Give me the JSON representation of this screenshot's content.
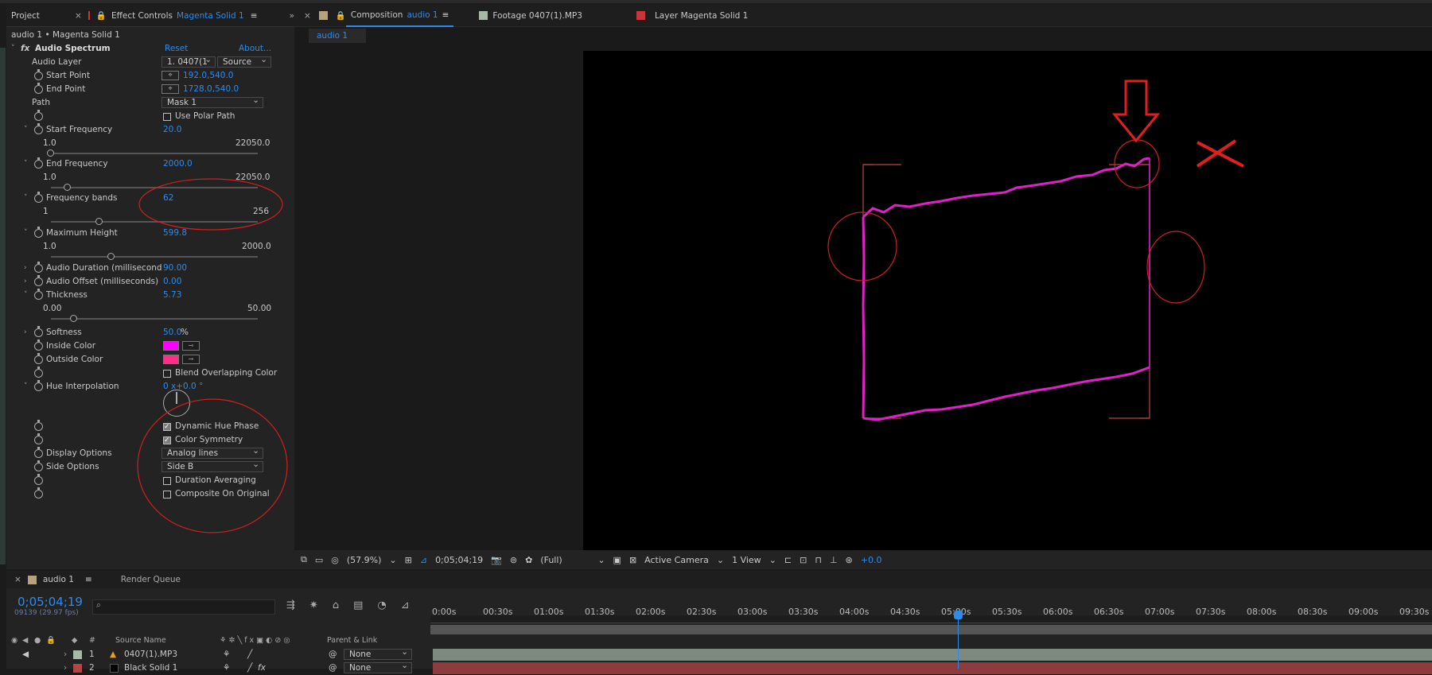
{
  "effect_panel": {
    "tab_project": "Project",
    "tab_effect_prefix": "Effect Controls",
    "tab_effect_layer": "Magenta Solid 1",
    "breadcrumb": "audio 1 • Magenta Solid 1",
    "effect_name": "Audio Spectrum",
    "reset": "Reset",
    "about": "About...",
    "audio_layer_label": "Audio Layer",
    "audio_layer_value": "1. 0407(1",
    "audio_layer_source": "Source",
    "start_point_label": "Start Point",
    "start_point_value": "192.0,540.0",
    "end_point_label": "End Point",
    "end_point_value": "1728.0,540.0",
    "path_label": "Path",
    "path_value": "Mask 1",
    "use_polar_path": "Use Polar Path",
    "start_freq_label": "Start Frequency",
    "start_freq_value": "20.0",
    "start_freq_min": "1.0",
    "start_freq_max": "22050.0",
    "end_freq_label": "End Frequency",
    "end_freq_value": "2000.0",
    "end_freq_min": "1.0",
    "end_freq_max": "22050.0",
    "bands_label": "Frequency bands",
    "bands_value": "62",
    "bands_min": "1",
    "bands_max": "256",
    "max_height_label": "Maximum Height",
    "max_height_value": "599.8",
    "max_height_min": "1.0",
    "max_height_max": "2000.0",
    "audio_duration_label": "Audio Duration (millisecond",
    "audio_duration_value": "90.00",
    "audio_offset_label": "Audio Offset (milliseconds)",
    "audio_offset_value": "0.00",
    "thickness_label": "Thickness",
    "thickness_value": "5.73",
    "thickness_min": "0.00",
    "thickness_max": "50.00",
    "softness_label": "Softness",
    "softness_value": "50.0",
    "softness_unit": "%",
    "inside_color_label": "Inside Color",
    "inside_color": "#ff00ff",
    "outside_color_label": "Outside Color",
    "outside_color": "#ff2e8a",
    "blend_label": "Blend Overlapping Color",
    "hue_label": "Hue Interpolation",
    "hue_value": "0 x+0.0 °",
    "dynamic_hue": "Dynamic Hue Phase",
    "color_symmetry": "Color Symmetry",
    "display_options_label": "Display Options",
    "display_options_value": "Analog lines",
    "side_options_label": "Side Options",
    "side_options_value": "Side B",
    "duration_averaging": "Duration Averaging",
    "composite_original": "Composite On Original"
  },
  "composition_panel": {
    "tab_comp_prefix": "Composition",
    "tab_comp_name": "audio 1",
    "tab_footage": "Footage 0407(1).MP3",
    "tab_layer": "Layer Magenta Solid 1",
    "view_tab": "audio 1",
    "zoom": "(57.9%)",
    "timecode": "0;05;04;19",
    "resolution": "(Full)",
    "camera": "Active Camera",
    "views": "1 View",
    "exposure": "+0.0"
  },
  "timeline": {
    "tab_comp": "audio 1",
    "tab_render": "Render Queue",
    "timecode": "0;05;04;19",
    "fps": "09139 (29.97 fps)",
    "ticks": [
      "0:00s",
      "00:30s",
      "01:00s",
      "01:30s",
      "02:00s",
      "02:30s",
      "03:00s",
      "03:30s",
      "04:00s",
      "04:30s",
      "05:00s",
      "05:30s",
      "06:00s",
      "06:30s",
      "07:00s",
      "07:30s",
      "08:00s",
      "08:30s",
      "09:00s",
      "09:30s"
    ],
    "col_num": "#",
    "col_source": "Source Name",
    "col_parent": "Parent & Link",
    "layers": [
      {
        "num": "1",
        "name": "0407(1).MP3",
        "parent": "None",
        "color": "#a8b8a8"
      },
      {
        "num": "2",
        "name": "Black Solid 1",
        "parent": "None",
        "color": "#b34545"
      }
    ]
  },
  "accent_color": "#2d8ceb"
}
